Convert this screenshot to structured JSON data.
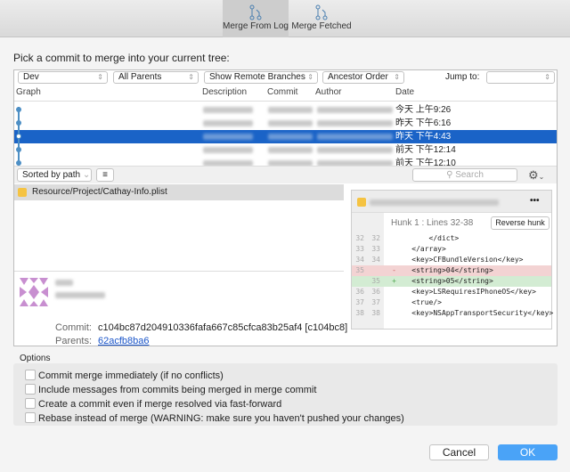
{
  "toolbar": {
    "tabs": [
      {
        "label": "Merge From Log",
        "selected": true
      },
      {
        "label": "Merge Fetched",
        "selected": false
      }
    ]
  },
  "prompt": "Pick a commit to merge into your current tree:",
  "filters": {
    "branch": "Dev",
    "parents": "All Parents",
    "remote": "Show Remote Branches",
    "order": "Ancestor Order",
    "jump_label": "Jump to:",
    "jump_value": ""
  },
  "columns": [
    "Graph",
    "Description",
    "Commit",
    "Author",
    "Date"
  ],
  "commits": [
    {
      "date": "今天 上午9:26"
    },
    {
      "date": "昨天 下午6:16"
    },
    {
      "date": "昨天 下午4:43",
      "selected": true
    },
    {
      "date": "前天 下午12:14"
    },
    {
      "date": "前天 下午12:10"
    }
  ],
  "file_toolbar": {
    "sort": "Sorted by path",
    "search_placeholder": "Search"
  },
  "files": [
    "Resource/Project/Cathay-Info.plist"
  ],
  "diff": {
    "hunk_title": "Hunk 1 : Lines 32-38",
    "reverse_label": "Reverse hunk",
    "more": "•••",
    "lines": [
      {
        "old": "32",
        "new": "32",
        "type": "ctx",
        "text": "        </dict>"
      },
      {
        "old": "33",
        "new": "33",
        "type": "ctx",
        "text": "    </array>"
      },
      {
        "old": "34",
        "new": "34",
        "type": "ctx",
        "text": "    <key>CFBundleVersion</key>"
      },
      {
        "old": "35",
        "new": "",
        "type": "del",
        "sign": "-",
        "text": "    <string>04</string>"
      },
      {
        "old": "",
        "new": "35",
        "type": "add",
        "sign": "+",
        "text": "    <string>05</string>"
      },
      {
        "old": "36",
        "new": "36",
        "type": "ctx",
        "text": "    <key>LSRequiresIPhoneOS</key>"
      },
      {
        "old": "37",
        "new": "37",
        "type": "ctx",
        "text": "    <true/>"
      },
      {
        "old": "38",
        "new": "38",
        "type": "ctx",
        "text": "    <key>NSAppTransportSecurity</key>"
      }
    ]
  },
  "commit_info": {
    "commit_label": "Commit:",
    "commit_value": "c104bc87d204910336fafa667c85cfca83b25af4 [c104bc8]",
    "parents_label": "Parents:",
    "parents_value": "62acfb8ba6"
  },
  "options": {
    "title": "Options",
    "items": [
      "Commit merge immediately (if no conflicts)",
      "Include messages from commits being merged in merge commit",
      "Create a commit even if merge resolved via fast-forward",
      "Rebase instead of merge (WARNING: make sure you haven't pushed your changes)"
    ]
  },
  "buttons": {
    "cancel": "Cancel",
    "ok": "OK"
  },
  "colors": {
    "selection": "#1a63c7",
    "ok_button": "#4aa3f7",
    "link": "#1a55c9"
  }
}
